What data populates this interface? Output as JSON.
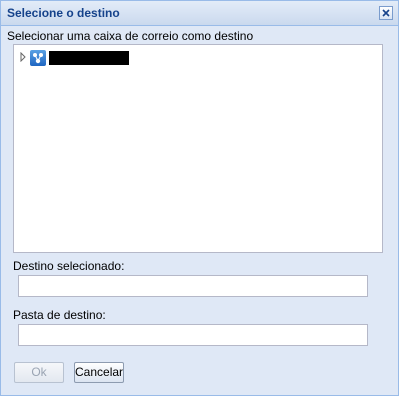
{
  "dialog": {
    "title": "Selecione o destino",
    "close_icon": "close-icon"
  },
  "tree": {
    "heading": "Selecionar uma caixa de correio como destino",
    "nodes": [
      {
        "icon": "mailbox-org-icon",
        "label": ""
      }
    ]
  },
  "destination": {
    "label": "Destino selecionado:",
    "value": ""
  },
  "folder": {
    "label": "Pasta de destino:",
    "value": ""
  },
  "buttons": {
    "ok_label": "Ok",
    "cancel_label": "Cancelar"
  },
  "colors": {
    "title_text": "#15428b",
    "panel_background": "#dfe8f6",
    "border": "#99bbe8"
  }
}
